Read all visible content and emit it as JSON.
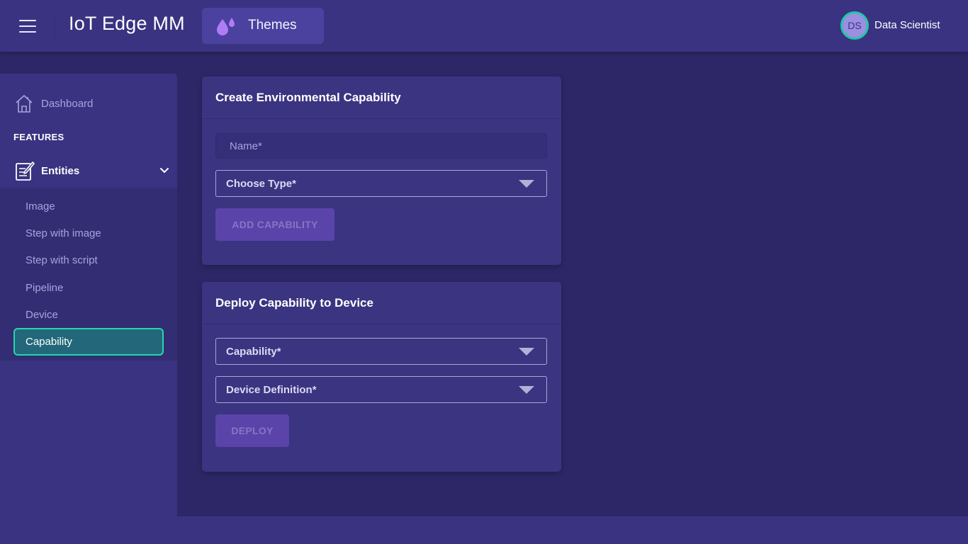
{
  "header": {
    "app_title": "IoT Edge MM",
    "themes_label": "Themes",
    "avatar_initials": "DS",
    "user_name": "Data Scientist"
  },
  "sidebar": {
    "dashboard_label": "Dashboard",
    "section_label": "FEATURES",
    "group_label": "Entities",
    "items": [
      {
        "label": "Image"
      },
      {
        "label": "Step with image"
      },
      {
        "label": "Step with script"
      },
      {
        "label": "Pipeline"
      },
      {
        "label": "Device"
      },
      {
        "label": "Capability",
        "active": true
      }
    ]
  },
  "create_card": {
    "title": "Create Environmental Capability",
    "name_placeholder": "Name*",
    "type_label": "Choose Type*",
    "button_label": "ADD CAPABILITY"
  },
  "deploy_card": {
    "title": "Deploy Capability to Device",
    "capability_label": "Capability*",
    "device_label": "Device Definition*",
    "button_label": "DEPLOY"
  },
  "colors": {
    "background": "#2d2767",
    "surface": "#3a3381",
    "accent": "#28d6ad",
    "themes_button": "#4b42a0"
  }
}
